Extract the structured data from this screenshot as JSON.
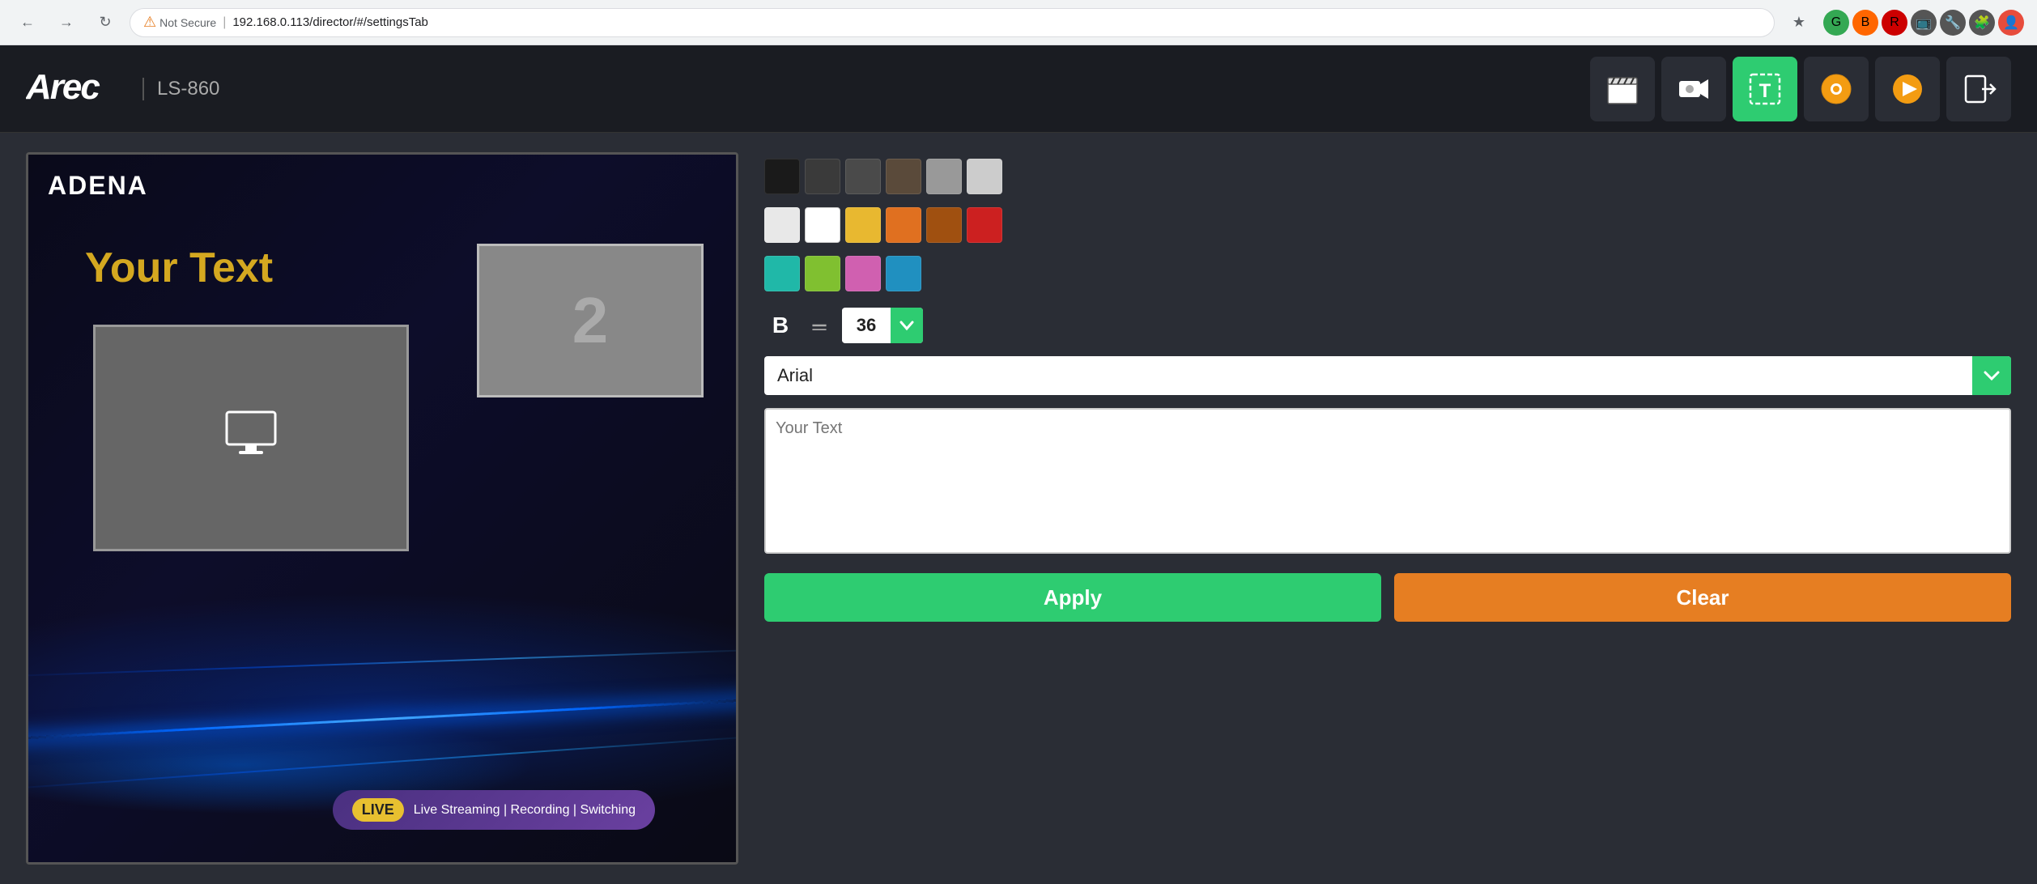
{
  "browser": {
    "back_icon": "←",
    "forward_icon": "→",
    "reload_icon": "↻",
    "security_warning": "Not Secure",
    "url": "192.168.0.113/director/#/settingsTab",
    "star_icon": "☆",
    "ext_icons": [
      "🟢",
      "🟠",
      "🔴",
      "🟣",
      "⚙",
      "🧩",
      "🔵"
    ]
  },
  "header": {
    "logo": "Arec",
    "model": "LS-860",
    "nav_icons": [
      {
        "id": "clapperboard",
        "symbol": "🎬",
        "active": false
      },
      {
        "id": "camera",
        "symbol": "📷",
        "active": false
      },
      {
        "id": "text-overlay",
        "symbol": "T",
        "active": true
      },
      {
        "id": "settings",
        "symbol": "⚙",
        "active": false
      },
      {
        "id": "media",
        "symbol": "▶",
        "active": false
      },
      {
        "id": "logout",
        "symbol": "⏏",
        "active": false
      }
    ]
  },
  "preview": {
    "logo": "ADENA",
    "overlay_text": "Your Text",
    "source2_number": "2",
    "live_tag": "LIVE",
    "live_description": "Live Streaming | Recording | Switching"
  },
  "settings": {
    "colors_row1": [
      "#1a1a1a",
      "#3a3a3a",
      "#4a4a4a",
      "#5a4a3a",
      "#999999",
      "#cccccc"
    ],
    "colors_row2": [
      "#e8e8e8",
      "#ffffff",
      "#e8b830",
      "#e07020",
      "#a05010",
      "#cc2020"
    ],
    "colors_row3": [
      "#20b8a8",
      "#80c030",
      "#d060b0",
      "#2090c0"
    ],
    "bold_label": "B",
    "underline_label": "=",
    "font_size": "36",
    "font_name": "Arial",
    "text_content": "Your Text",
    "apply_label": "Apply",
    "clear_label": "Clear",
    "dropdown_icon": "▼"
  }
}
